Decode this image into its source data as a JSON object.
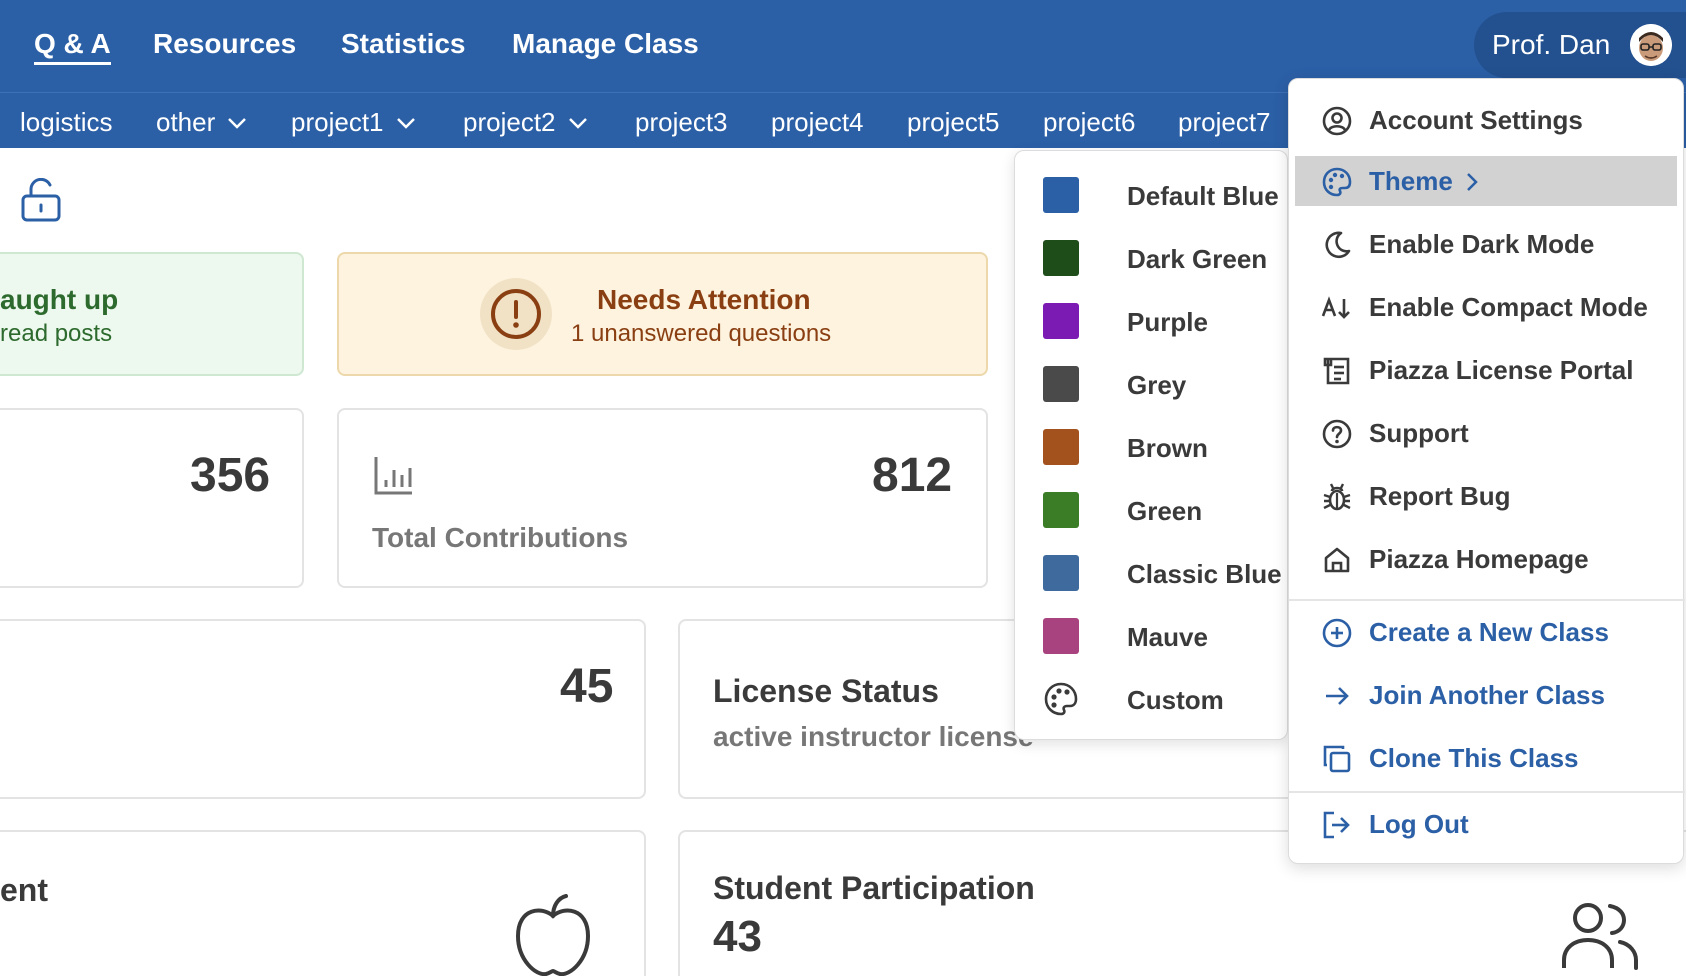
{
  "nav": {
    "links": [
      "Q & A",
      "Resources",
      "Statistics",
      "Manage Class"
    ],
    "user_name": "Prof. Dan"
  },
  "folders": [
    "logistics",
    "other",
    "project1",
    "project2",
    "project3",
    "project4",
    "project5",
    "project6",
    "project7"
  ],
  "dashboard": {
    "caught_up_title": "aught up",
    "caught_up_sub": "read posts",
    "attention_title": "Needs Attention",
    "attention_sub": "1 unanswered questions",
    "stat_left_value": "356",
    "contributions_value": "812",
    "contributions_label": "Total Contributions",
    "stat_45_value": "45",
    "license_title": "License Status",
    "license_sub": "active instructor license",
    "enrollment_title_partial": "ent",
    "participation_title": "Student Participation",
    "participation_value": "43"
  },
  "theme_menu": {
    "items": [
      {
        "label": "Default Blue",
        "color": "#2b5fa6"
      },
      {
        "label": "Dark Green",
        "color": "#1f4d1a"
      },
      {
        "label": "Purple",
        "color": "#7b1bb3"
      },
      {
        "label": "Grey",
        "color": "#4a4a4a"
      },
      {
        "label": "Brown",
        "color": "#a3521d"
      },
      {
        "label": "Green",
        "color": "#3a7d26"
      },
      {
        "label": "Classic Blue",
        "color": "#3e6a9e"
      },
      {
        "label": "Mauve",
        "color": "#a8437f"
      },
      {
        "label": "Custom",
        "color": ""
      }
    ]
  },
  "account_menu": {
    "account_settings": "Account Settings",
    "theme": "Theme",
    "dark_mode": "Enable Dark Mode",
    "compact_mode": "Enable Compact Mode",
    "license_portal": "Piazza License Portal",
    "support": "Support",
    "report_bug": "Report Bug",
    "homepage": "Piazza Homepage",
    "create_class": "Create a New Class",
    "join_class": "Join Another Class",
    "clone_class": "Clone This Class",
    "log_out": "Log Out"
  },
  "colors": {
    "brand_blue": "#2b5fa6",
    "attention_brown": "#8a3f12",
    "caught_up_green": "#2d6a2d"
  }
}
